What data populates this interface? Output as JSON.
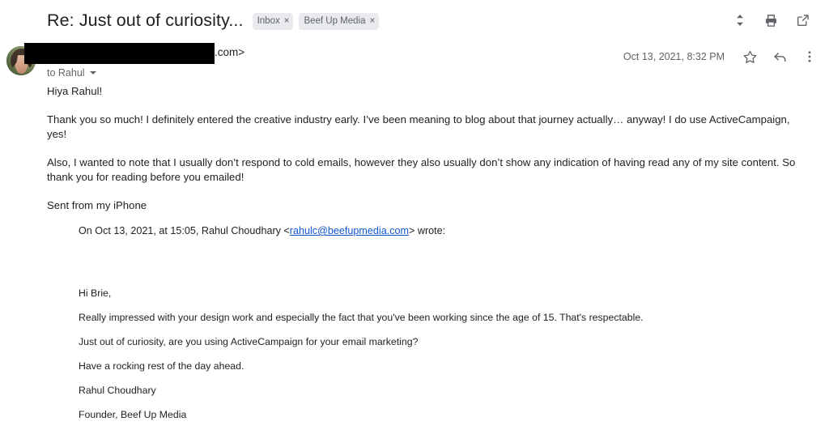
{
  "header": {
    "subject": "Re: Just out of curiosity...",
    "labels": [
      {
        "name": "Inbox",
        "remove": "×"
      },
      {
        "name": "Beef Up Media",
        "remove": "×"
      }
    ],
    "actions": [
      {
        "icon": "expand-collapse-icon",
        "label": "Expand all"
      },
      {
        "icon": "print-icon",
        "label": "Print all"
      },
      {
        "icon": "open-in-new-window-icon",
        "label": "Open in new window"
      }
    ]
  },
  "message": {
    "sender": {
      "avatar_alt": "Sender profile photo",
      "redacted_address": "",
      "address_tail": ".com>",
      "recipient_line": "to Rahul"
    },
    "timestamp": "Oct 13, 2021, 8:32 PM",
    "meta_actions": [
      {
        "icon": "star-icon",
        "label": "Star"
      },
      {
        "icon": "reply-icon",
        "label": "Reply"
      },
      {
        "icon": "more-options-icon",
        "label": "More"
      }
    ],
    "body": {
      "greeting": "Hiya Rahul!",
      "paragraph_1": "Thank you so much! I definitely entered the creative industry early. I’ve been meaning to blog about that journey actually… anyway! I do use ActiveCampaign, yes!",
      "paragraph_2": "Also, I wanted to note that I usually don’t respond to cold emails, however they also usually don’t show any indication of having read any of my site content. So thank you for reading before you emailed!",
      "signature": "Sent from my iPhone"
    }
  },
  "quoted_message": {
    "header_prefix": "On Oct 13, 2021, at 15:05, Rahul Choudhary <",
    "header_email": "rahulc@beefupmedia.com",
    "header_suffix": "> wrote:",
    "greeting": "Hi Brie,",
    "paragraph_1": "Really impressed with your design work and especially the fact that you've been working since the age of 15. That's respectable.",
    "paragraph_2": "Just out of curiosity, are you using ActiveCampaign for your email marketing?",
    "paragraph_3": "Have a rocking rest of the day ahead.",
    "signature_name": "Rahul Choudhary",
    "signature_title": "Founder, Beef Up Media"
  },
  "colors": {
    "text_primary": "#202124",
    "text_body": "#222222",
    "text_secondary": "#5f6368",
    "link": "#1155cc",
    "chip_background": "#e8eaed",
    "redaction": "#000000"
  }
}
